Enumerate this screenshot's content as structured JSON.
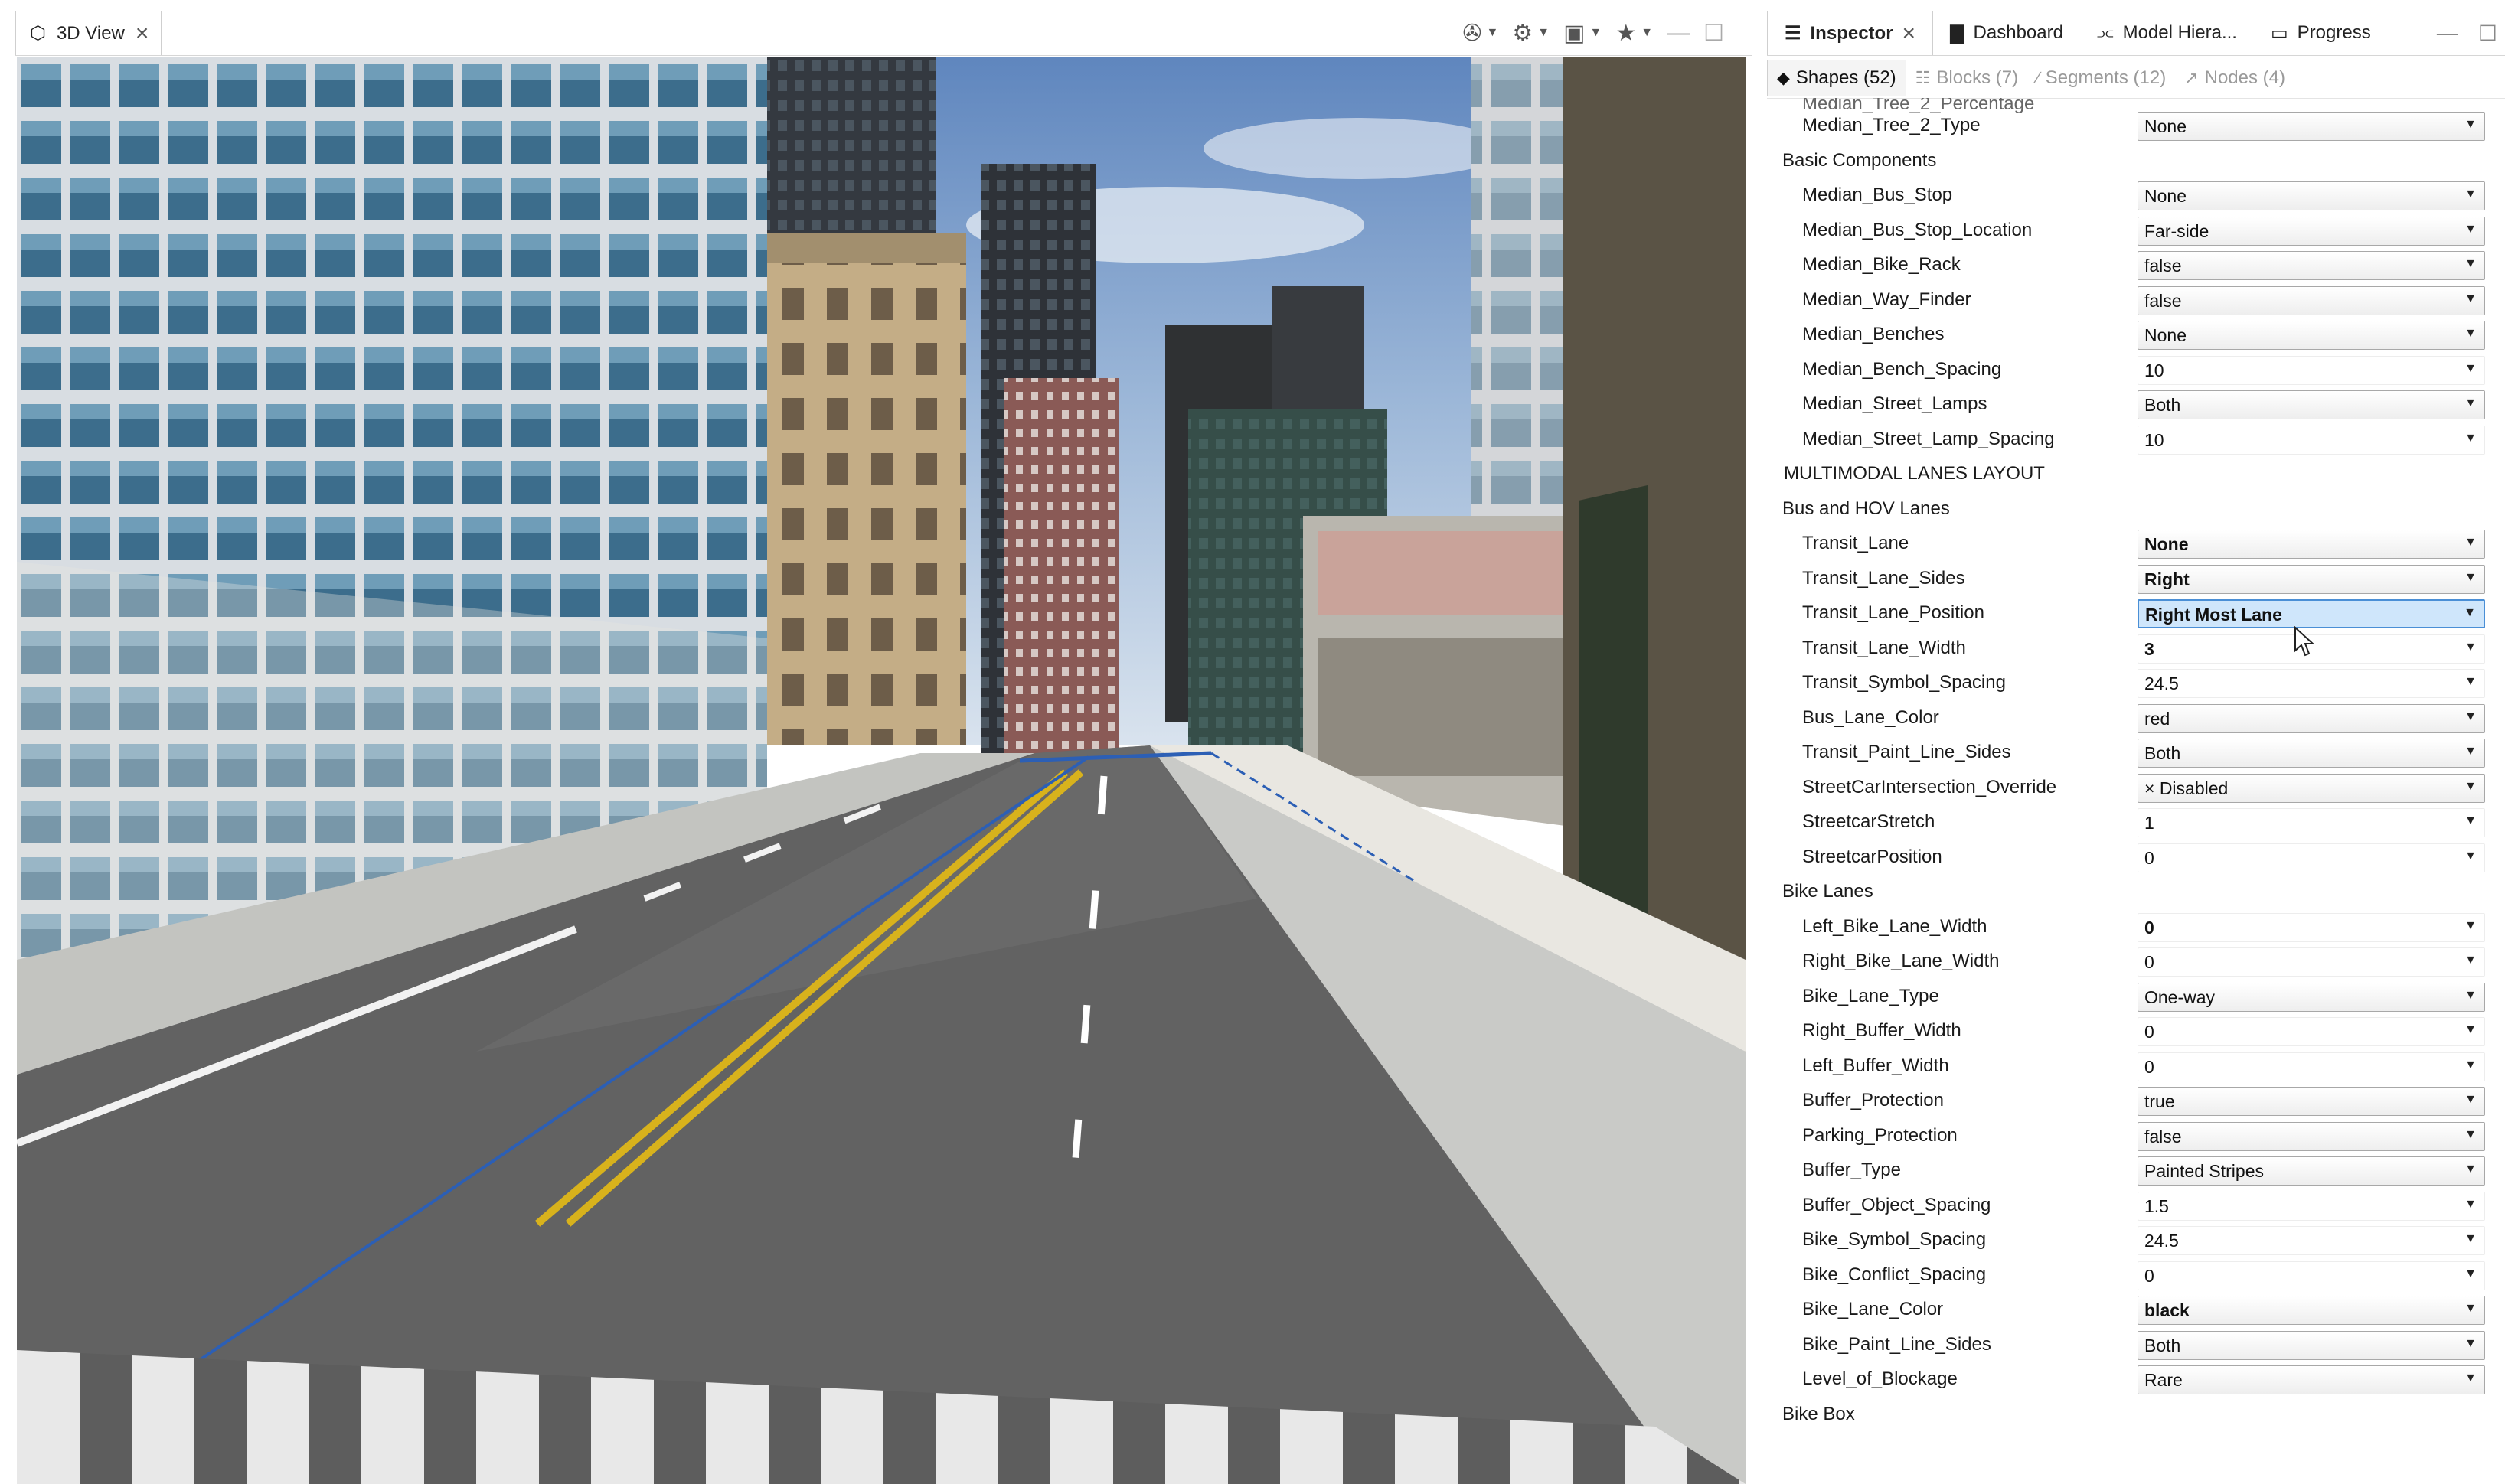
{
  "left_panel": {
    "tab_label": "3D View"
  },
  "inspector": {
    "tabs": [
      {
        "label": "Inspector",
        "icon": "sliders-icon",
        "active": true
      },
      {
        "label": "Dashboard",
        "icon": "bar-chart-icon"
      },
      {
        "label": "Model Hiera...",
        "icon": "hierarchy-icon"
      },
      {
        "label": "Progress",
        "icon": "progress-icon"
      }
    ],
    "subtabs": [
      {
        "label": "Shapes (52)",
        "icon": "shapes-icon",
        "active": true
      },
      {
        "label": "Blocks (7)",
        "icon": "blocks-icon"
      },
      {
        "label": "Segments (12)",
        "icon": "segments-icon"
      },
      {
        "label": "Nodes (4)",
        "icon": "nodes-icon"
      }
    ],
    "clipped_row": "Median_Tree_2_Percentage",
    "rows": [
      {
        "kind": "prop",
        "label": "Median_Tree_2_Type",
        "value": "None",
        "style": "dd"
      },
      {
        "kind": "sec",
        "label": "Basic Components"
      },
      {
        "kind": "prop",
        "label": "Median_Bus_Stop",
        "value": "None",
        "style": "dd"
      },
      {
        "kind": "prop",
        "label": "Median_Bus_Stop_Location",
        "value": "Far-side",
        "style": "dd"
      },
      {
        "kind": "prop",
        "label": "Median_Bike_Rack",
        "value": "false",
        "style": "dd"
      },
      {
        "kind": "prop",
        "label": "Median_Way_Finder",
        "value": "false",
        "style": "dd"
      },
      {
        "kind": "prop",
        "label": "Median_Benches",
        "value": "None",
        "style": "dd"
      },
      {
        "kind": "prop",
        "label": "Median_Bench_Spacing",
        "value": "10",
        "style": "plain"
      },
      {
        "kind": "prop",
        "label": "Median_Street_Lamps",
        "value": "Both",
        "style": "dd"
      },
      {
        "kind": "prop",
        "label": "Median_Street_Lamp_Spacing",
        "value": "10",
        "style": "plain"
      },
      {
        "kind": "cat",
        "label": "MULTIMODAL LANES LAYOUT"
      },
      {
        "kind": "sec",
        "label": "Bus and HOV Lanes"
      },
      {
        "kind": "prop",
        "label": "Transit_Lane",
        "value": "None",
        "style": "dd",
        "bold": true
      },
      {
        "kind": "prop",
        "label": "Transit_Lane_Sides",
        "value": "Right",
        "style": "dd",
        "bold": true
      },
      {
        "kind": "prop",
        "label": "Transit_Lane_Position",
        "value": "Right Most Lane",
        "style": "sel",
        "bold": true
      },
      {
        "kind": "prop",
        "label": "Transit_Lane_Width",
        "value": "3",
        "style": "plain",
        "bold": true
      },
      {
        "kind": "prop",
        "label": "Transit_Symbol_Spacing",
        "value": "24.5",
        "style": "plain"
      },
      {
        "kind": "prop",
        "label": "Bus_Lane_Color",
        "value": "red",
        "style": "dd"
      },
      {
        "kind": "prop",
        "label": "Transit_Paint_Line_Sides",
        "value": "Both",
        "style": "dd"
      },
      {
        "kind": "prop",
        "label": "StreetCarIntersection_Override",
        "value": "× Disabled",
        "style": "dd"
      },
      {
        "kind": "prop",
        "label": "StreetcarStretch",
        "value": "1",
        "style": "plain"
      },
      {
        "kind": "prop",
        "label": "StreetcarPosition",
        "value": "0",
        "style": "plain"
      },
      {
        "kind": "sec",
        "label": "Bike Lanes"
      },
      {
        "kind": "prop",
        "label": "Left_Bike_Lane_Width",
        "value": "0",
        "style": "plain",
        "bold": true
      },
      {
        "kind": "prop",
        "label": "Right_Bike_Lane_Width",
        "value": "0",
        "style": "plain"
      },
      {
        "kind": "prop",
        "label": "Bike_Lane_Type",
        "value": "One-way",
        "style": "dd"
      },
      {
        "kind": "prop",
        "label": "Right_Buffer_Width",
        "value": "0",
        "style": "plain"
      },
      {
        "kind": "prop",
        "label": "Left_Buffer_Width",
        "value": "0",
        "style": "plain"
      },
      {
        "kind": "prop",
        "label": "Buffer_Protection",
        "value": "true",
        "style": "dd"
      },
      {
        "kind": "prop",
        "label": "Parking_Protection",
        "value": "false",
        "style": "dd"
      },
      {
        "kind": "prop",
        "label": "Buffer_Type",
        "value": "Painted Stripes",
        "style": "dd"
      },
      {
        "kind": "prop",
        "label": "Buffer_Object_Spacing",
        "value": "1.5",
        "style": "plain"
      },
      {
        "kind": "prop",
        "label": "Bike_Symbol_Spacing",
        "value": "24.5",
        "style": "plain"
      },
      {
        "kind": "prop",
        "label": "Bike_Conflict_Spacing",
        "value": "0",
        "style": "plain"
      },
      {
        "kind": "prop",
        "label": "Bike_Lane_Color",
        "value": "black",
        "style": "dd",
        "bold": true
      },
      {
        "kind": "prop",
        "label": "Bike_Paint_Line_Sides",
        "value": "Both",
        "style": "dd"
      },
      {
        "kind": "prop",
        "label": "Level_of_Blockage",
        "value": "Rare",
        "style": "dd"
      },
      {
        "kind": "sec",
        "label": "Bike Box"
      }
    ]
  }
}
